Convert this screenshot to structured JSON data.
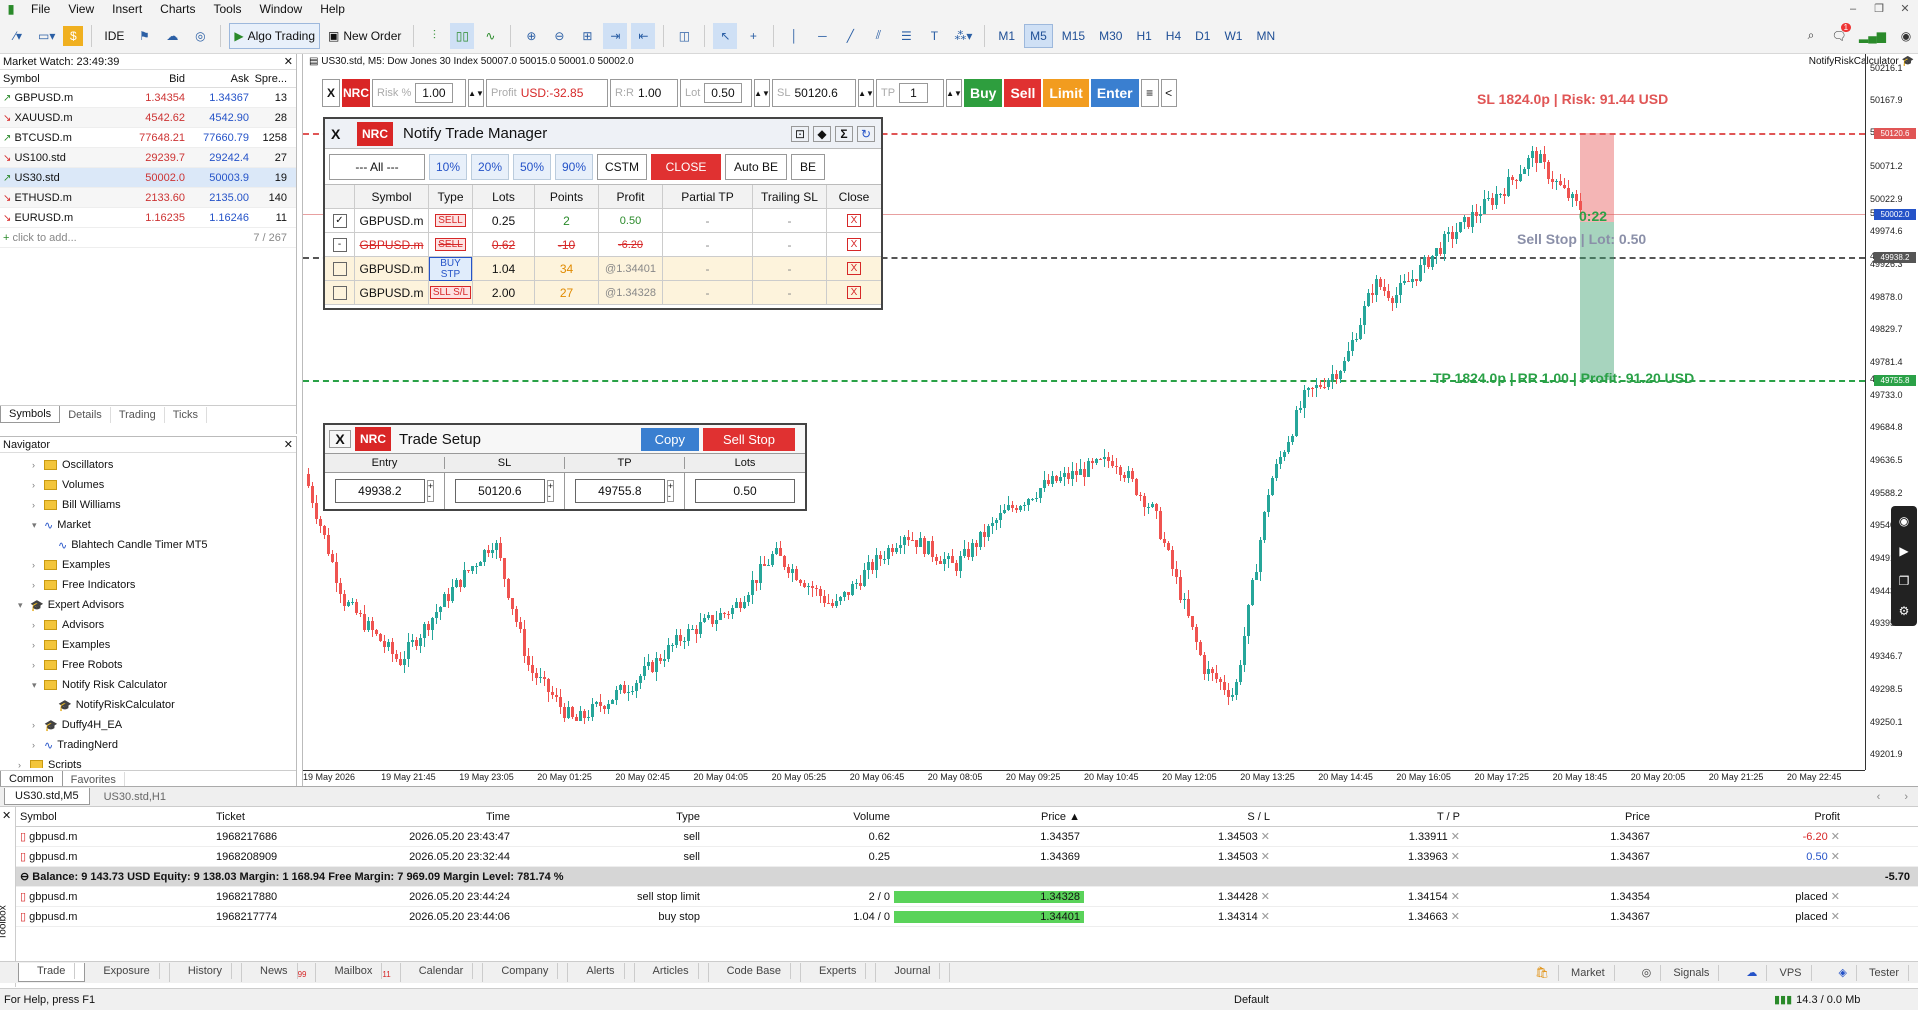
{
  "menu": {
    "items": [
      "File",
      "View",
      "Insert",
      "Charts",
      "Tools",
      "Window",
      "Help"
    ]
  },
  "toolbar": {
    "ide": "IDE",
    "algo": "Algo Trading",
    "new_order": "New Order",
    "timeframes": [
      "M1",
      "M5",
      "M15",
      "M30",
      "H1",
      "H4",
      "D1",
      "W1",
      "MN"
    ],
    "active_tf": "M5",
    "notif_count": "1"
  },
  "market_watch": {
    "title": "Market Watch: 23:49:39",
    "headers": [
      "Symbol",
      "Bid",
      "Ask",
      "Spre..."
    ],
    "rows": [
      {
        "symbol": "GBPUSD.m",
        "bid": "1.34354",
        "ask": "1.34367",
        "spread": "13",
        "dir": "up"
      },
      {
        "symbol": "XAUUSD.m",
        "bid": "4542.62",
        "ask": "4542.90",
        "spread": "28",
        "dir": "down"
      },
      {
        "symbol": "BTCUSD.m",
        "bid": "77648.21",
        "ask": "77660.79",
        "spread": "1258",
        "dir": "up"
      },
      {
        "symbol": "US100.std",
        "bid": "29239.7",
        "ask": "29242.4",
        "spread": "27",
        "dir": "down"
      },
      {
        "symbol": "US30.std",
        "bid": "50002.0",
        "ask": "50003.9",
        "spread": "19",
        "dir": "up"
      },
      {
        "symbol": "ETHUSD.m",
        "bid": "2133.60",
        "ask": "2135.00",
        "spread": "140",
        "dir": "down"
      },
      {
        "symbol": "EURUSD.m",
        "bid": "1.16235",
        "ask": "1.16246",
        "spread": "11",
        "dir": "down"
      }
    ],
    "add": "click to add...",
    "count": "7 / 267",
    "tabs": [
      "Symbols",
      "Details",
      "Trading",
      "Ticks"
    ]
  },
  "navigator": {
    "title": "Navigator",
    "items": [
      {
        "label": "Oscillators",
        "indent": 2,
        "type": "folder"
      },
      {
        "label": "Volumes",
        "indent": 2,
        "type": "folder"
      },
      {
        "label": "Bill Williams",
        "indent": 2,
        "type": "folder"
      },
      {
        "label": "Market",
        "indent": 2,
        "type": "ind",
        "open": true
      },
      {
        "label": "Blahtech Candle Timer MT5",
        "indent": 3,
        "type": "ind"
      },
      {
        "label": "Examples",
        "indent": 2,
        "type": "folder"
      },
      {
        "label": "Free Indicators",
        "indent": 2,
        "type": "folder"
      },
      {
        "label": "Expert Advisors",
        "indent": 1,
        "type": "ea",
        "open": true
      },
      {
        "label": "Advisors",
        "indent": 2,
        "type": "folder"
      },
      {
        "label": "Examples",
        "indent": 2,
        "type": "folder"
      },
      {
        "label": "Free Robots",
        "indent": 2,
        "type": "folder"
      },
      {
        "label": "Notify Risk Calculator",
        "indent": 2,
        "type": "folder",
        "open": true
      },
      {
        "label": "NotifyRiskCalculator",
        "indent": 3,
        "type": "ea"
      },
      {
        "label": "Duffy4H_EA",
        "indent": 2,
        "type": "ea"
      },
      {
        "label": "TradingNerd",
        "indent": 2,
        "type": "ind"
      },
      {
        "label": "Scripts",
        "indent": 1,
        "type": "folder"
      },
      {
        "label": "Services",
        "indent": 1,
        "type": "folder"
      }
    ],
    "tabs": [
      "Common",
      "Favorites"
    ]
  },
  "chart": {
    "header": "US30.std, M5:  Dow Jones 30 Index  50007.0 50015.0 50001.0 50002.0",
    "ea_name": "NotifyRiskCalculator",
    "y_labels": [
      "50216.1",
      "50167.9",
      "50120.6",
      "50071.2",
      "50022.9",
      "50002.0",
      "49974.6",
      "49938.2",
      "49926.3",
      "49878.0",
      "49829.7",
      "49781.4",
      "49755.8",
      "49733.0",
      "49684.8",
      "49636.5",
      "49588.2",
      "49540.0",
      "49491.7",
      "49443.4",
      "49395.1",
      "49346.7",
      "49298.5",
      "49250.1",
      "49201.9"
    ],
    "x_labels": [
      "19 May 2026",
      "19 May 21:45",
      "19 May 23:05",
      "20 May 01:25",
      "20 May 02:45",
      "20 May 04:05",
      "20 May 05:25",
      "20 May 06:45",
      "20 May 08:05",
      "20 May 09:25",
      "20 May 10:45",
      "20 May 12:05",
      "20 May 13:25",
      "20 May 14:45",
      "20 May 16:05",
      "20 May 17:25",
      "20 May 18:45",
      "20 May 20:05",
      "20 May 21:25",
      "20 May 22:45"
    ],
    "sl_text": "SL  1824.0p  |  Risk: 91.44 USD",
    "tp_text": "TP  1824.0p  |  RR 1.00  |  Profit: 91.20 USD",
    "entry_text": "Sell Stop  |  Lot: 0.50",
    "timer": "0:22",
    "tabs": [
      "US30.std,M5",
      "US30.std,H1"
    ],
    "colors": {
      "bull": "#26a69a",
      "bear": "#ef5350",
      "sl": "#e05555",
      "tp": "#2aa147"
    }
  },
  "controls": {
    "x": "X",
    "nrc": "NRC",
    "risk_label": "Risk %",
    "risk": "1.00",
    "profit_label": "Profit",
    "profit": "USD:-32.85",
    "rr_label": "R:R",
    "rr": "1.00",
    "lot_label": "Lot",
    "lot": "0.50",
    "sl_label": "SL",
    "sl": "50120.6",
    "tp_label": "TP",
    "tp": "1",
    "buy": "Buy",
    "sell": "Sell",
    "limit": "Limit",
    "enter": "Enter",
    "menu": "≡",
    "collapse": "<"
  },
  "trade_manager": {
    "title": "Notify Trade Manager",
    "filter": "--- All ---",
    "pcts": [
      "10%",
      "20%",
      "50%",
      "90%"
    ],
    "cstm": "CSTM",
    "close": "CLOSE",
    "autobe": "Auto BE",
    "be": "BE",
    "headers": [
      "Symbol",
      "Type",
      "Lots",
      "Points",
      "Profit",
      "Partial TP",
      "Trailing SL",
      "Close"
    ],
    "rows": [
      {
        "symbol": "GBPUSD.m",
        "type": "SELL",
        "lots": "0.25",
        "points": "2",
        "profit": "0.50",
        "ptp": "-",
        "tsl": "-",
        "close": "X",
        "checked": "✓",
        "style": "sell"
      },
      {
        "symbol": "GBPUSD.m",
        "type": "SELL",
        "lots": "0.62",
        "points": "-10",
        "profit": "-6.20",
        "ptp": "-",
        "tsl": "-",
        "close": "X",
        "checked": "-",
        "style": "strike"
      },
      {
        "symbol": "GBPUSD.m",
        "type": "BUY STP",
        "lots": "1.04",
        "points": "34",
        "profit": "@1.34401",
        "ptp": "-",
        "tsl": "-",
        "close": "X",
        "checked": "",
        "style": "pending"
      },
      {
        "symbol": "GBPUSD.m",
        "type": "SLL S/L",
        "lots": "2.00",
        "points": "27",
        "profit": "@1.34328",
        "ptp": "-",
        "tsl": "-",
        "close": "X",
        "checked": "",
        "style": "pending"
      }
    ]
  },
  "trade_setup": {
    "title": "Trade Setup",
    "copy": "Copy",
    "action": "Sell Stop",
    "headers": [
      "Entry",
      "SL",
      "TP",
      "Lots"
    ],
    "values": [
      "49938.2",
      "50120.6",
      "49755.8",
      "0.50"
    ]
  },
  "trades": {
    "headers": [
      "Symbol",
      "Ticket",
      "Time",
      "Type",
      "Volume",
      "Price",
      "S / L",
      "T / P",
      "Price",
      "Profit"
    ],
    "rows": [
      {
        "symbol": "gbpusd.m",
        "ticket": "1968217686",
        "time": "2026.05.20 23:43:47",
        "type": "sell",
        "volume": "0.62",
        "price": "1.34357",
        "sl": "1.34503",
        "tp": "1.33911",
        "cur": "1.34367",
        "profit": "-6.20",
        "pclass": "neg",
        "hl": false
      },
      {
        "symbol": "gbpusd.m",
        "ticket": "1968208909",
        "time": "2026.05.20 23:32:44",
        "type": "sell",
        "volume": "0.25",
        "price": "1.34369",
        "sl": "1.34503",
        "tp": "1.33963",
        "cur": "1.34367",
        "profit": "0.50",
        "pclass": "pos",
        "hl": false
      }
    ],
    "summary": "Balance: 9 143.73 USD  Equity: 9 138.03  Margin: 1 168.94  Free Margin: 7 969.09  Margin Level: 781.74 %",
    "summary_profit": "-5.70",
    "orders": [
      {
        "symbol": "gbpusd.m",
        "ticket": "1968217880",
        "time": "2026.05.20 23:44:24",
        "type": "sell stop limit",
        "volume": "2 / 0",
        "price": "1.34328",
        "sl": "1.34428",
        "tp": "1.34154",
        "cur": "1.34354",
        "profit": "placed"
      },
      {
        "symbol": "gbpusd.m",
        "ticket": "1968217774",
        "time": "2026.05.20 23:44:06",
        "type": "buy stop",
        "volume": "1.04 / 0",
        "price": "1.34401",
        "sl": "1.34314",
        "tp": "1.34663",
        "cur": "1.34367",
        "profit": "placed"
      }
    ]
  },
  "bottom_tabs": [
    "Trade",
    "Exposure",
    "History",
    "News",
    "Mailbox",
    "Calendar",
    "Company",
    "Alerts",
    "Articles",
    "Code Base",
    "Experts",
    "Journal"
  ],
  "bottom_badges": {
    "news": "99",
    "mailbox": "11"
  },
  "bottom_right": [
    "Market",
    "Signals",
    "VPS",
    "Tester"
  ],
  "toolbox": "Toolbox",
  "status": {
    "help": "For Help, press F1",
    "profile": "Default",
    "net": "14.3 / 0.0 Mb"
  }
}
